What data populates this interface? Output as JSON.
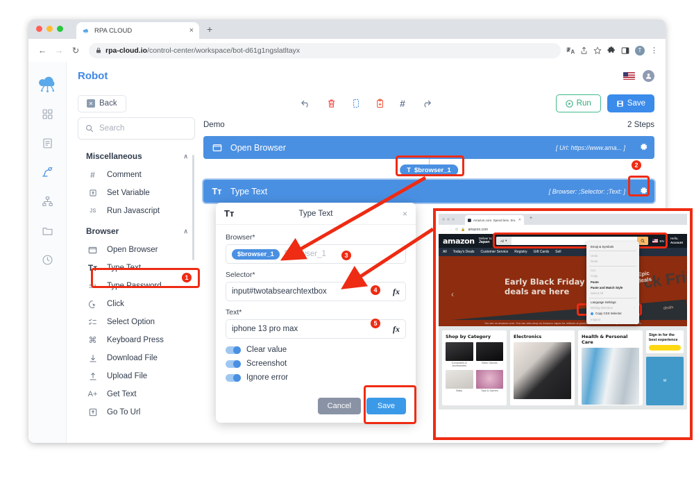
{
  "browser": {
    "tab_title": "RPA CLOUD",
    "tab_close": "×",
    "new_tab": "+",
    "url_domain": "rpa-cloud.io",
    "url_path": "/control-center/workspace/bot-d61g1ngslatltayx",
    "back": "←",
    "forward": "→",
    "reload": "↻",
    "lock": "🔒",
    "profile_initial": "T",
    "menu": "⋮"
  },
  "app": {
    "title": "Robot",
    "rail": [
      {
        "name": "logo",
        "glyph": "cloud"
      },
      {
        "name": "dashboard",
        "glyph": "grid"
      },
      {
        "name": "documents",
        "glyph": "doc"
      },
      {
        "name": "robot",
        "glyph": "robot",
        "active": true
      },
      {
        "name": "workflows",
        "glyph": "sitemap"
      },
      {
        "name": "files",
        "glyph": "folder"
      },
      {
        "name": "history",
        "glyph": "clock"
      }
    ],
    "toolbar": {
      "back_label": "Back",
      "undo": "undo-icon",
      "delete": "trash-icon",
      "copy": "copy-icon",
      "paste": "paste-icon",
      "hash": "#",
      "redo": "redo-icon",
      "run_label": "Run",
      "save_label": "Save"
    }
  },
  "sidebar": {
    "search_placeholder": "Search",
    "groups": [
      {
        "label": "Miscellaneous",
        "chevron": "∧",
        "items": [
          {
            "label": "Comment",
            "icon": "hash-icon"
          },
          {
            "label": "Set Variable",
            "icon": "variable-icon"
          },
          {
            "label": "Run Javascript",
            "icon": "javascript-icon"
          }
        ]
      },
      {
        "label": "Browser",
        "chevron": "∧",
        "items": [
          {
            "label": "Open Browser",
            "icon": "window-icon"
          },
          {
            "label": "Type Text",
            "icon": "text-icon",
            "highlighted": true,
            "badge": "1"
          },
          {
            "label": "Type Password",
            "icon": "password-icon"
          },
          {
            "label": "Click",
            "icon": "cursor-icon"
          },
          {
            "label": "Select Option",
            "icon": "checklist-icon"
          },
          {
            "label": "Keyboard Press",
            "icon": "command-icon"
          },
          {
            "label": "Download File",
            "icon": "download-icon"
          },
          {
            "label": "Upload File",
            "icon": "upload-icon"
          },
          {
            "label": "Get Text",
            "icon": "a-plus-icon"
          },
          {
            "label": "Go To Url",
            "icon": "goto-icon"
          }
        ]
      }
    ]
  },
  "canvas": {
    "flow_name": "Demo",
    "step_count": "2 Steps",
    "steps": [
      {
        "name": "Open Browser",
        "meta": "[ Url: https://www.ama... ]",
        "icon": "window-icon"
      },
      {
        "name": "Type Text",
        "meta": "[ Browser:  ;Selector:  ;Text: ]",
        "icon": "text-icon",
        "selected": true,
        "badge": "2"
      }
    ],
    "variable_pill": {
      "prefix": "T",
      "label": "$browser_1"
    }
  },
  "dialog": {
    "icon": "Tт",
    "title": "Type Text",
    "close": "×",
    "fields": [
      {
        "label": "Browser*",
        "chip": "$browser_1",
        "ghost": "$browser_1",
        "badge": "3",
        "fx": false
      },
      {
        "label": "Selector*",
        "value": "input#twotabsearchtextbox",
        "badge": "4",
        "fx": true,
        "fx_label": "fx"
      },
      {
        "label": "Text*",
        "value": "iphone 13 pro max",
        "badge": "5",
        "fx": true,
        "fx_label": "fx"
      }
    ],
    "toggles": [
      {
        "label": "Clear value",
        "on": true
      },
      {
        "label": "Screenshot",
        "on": true
      },
      {
        "label": "Ignore error",
        "on": true
      }
    ],
    "cancel_label": "Cancel",
    "save_label": "Save"
  },
  "shot": {
    "tab_title": "Amazon.com. Spend less. Sm...",
    "url": "amazon.com",
    "amazon": {
      "logo": "amazon",
      "deliver_to_small": "Deliver to",
      "deliver_to_big": "Japan",
      "search_category": "All",
      "search_value": "",
      "lang": "EN",
      "account_line1": "Hello,",
      "account_line2": "Account",
      "nav": [
        "All",
        "Today's Deals",
        "Customer Service",
        "Registry",
        "Gift Cards",
        "Sell"
      ],
      "hero_line1": "Early Black Friday",
      "hero_line2": "deals are here",
      "hero_epic1": "Epic",
      "hero_epic2": "deals",
      "hero_blackfriday": "ck Frid",
      "hero_deals_small": "deals",
      "strip_text": "You are on amazon.com. You can also shop on Amazon Japan for millions of products with fast local delivery.",
      "strip_link": "Click here to go to",
      "cards": [
        {
          "title": "Shop by Category",
          "cells": [
            "Computers & Accessories",
            "Video Games",
            "Baby",
            "Toys & Games"
          ]
        },
        {
          "title": "Electronics"
        },
        {
          "title": "Health & Personal Care"
        }
      ],
      "side_card_title": "Sign in for the best experience",
      "side_card2": "W"
    },
    "context_menu": [
      {
        "label": "Emoji & Symbols",
        "state": "normal"
      },
      {
        "label": "Undo",
        "state": "dim"
      },
      {
        "label": "Redo",
        "state": "dim"
      },
      {
        "label": "Cut",
        "state": "dim"
      },
      {
        "label": "Copy",
        "state": "dim"
      },
      {
        "label": "Paste",
        "state": "bold"
      },
      {
        "label": "Paste and Match Style",
        "state": "bold"
      },
      {
        "label": "Select All",
        "state": "dim"
      },
      {
        "label": "Language Settings",
        "state": "normal"
      },
      {
        "label": "Writing Direction",
        "state": "dim",
        "submenu": "›"
      },
      {
        "label": "Copy CSS Selector",
        "state": "css",
        "highlighted": true
      },
      {
        "label": "Inspect",
        "state": "dim"
      }
    ]
  },
  "annotations": {
    "accent": "#ee2b13",
    "badges": [
      "1",
      "2",
      "3",
      "4",
      "5"
    ]
  }
}
